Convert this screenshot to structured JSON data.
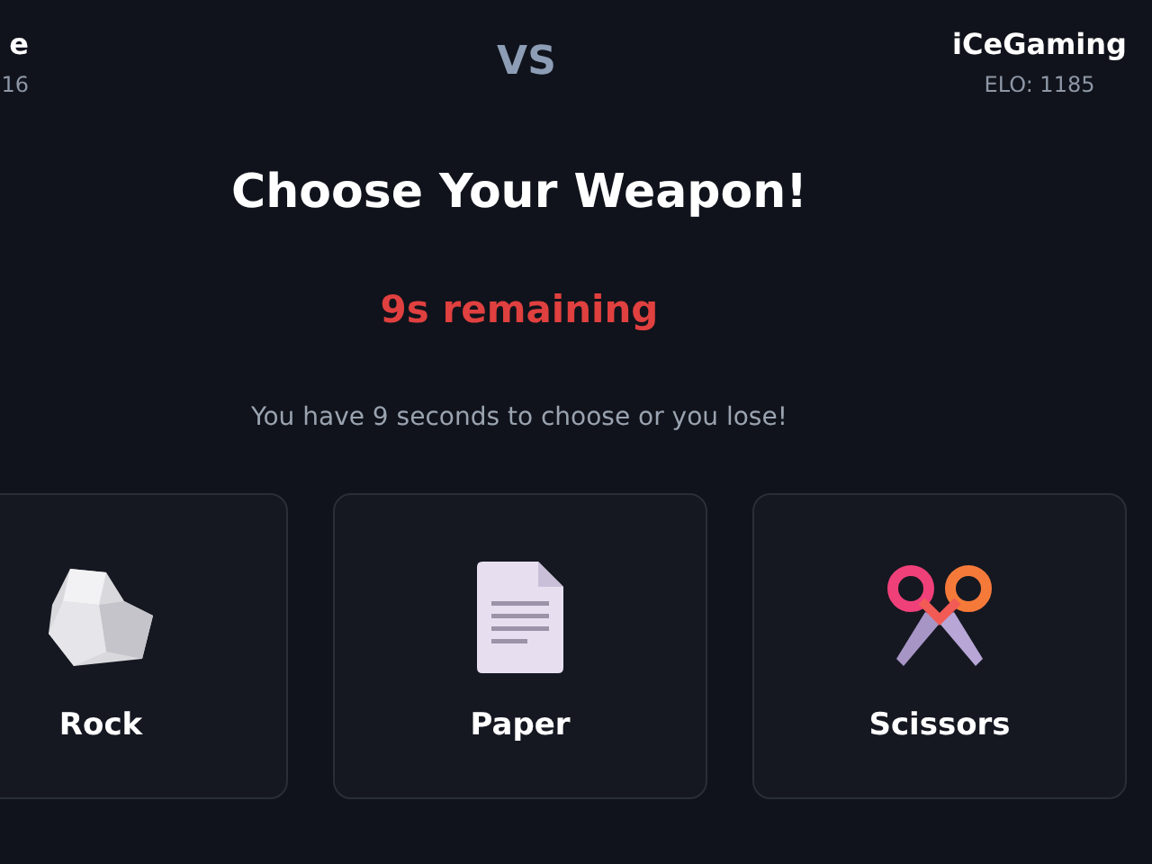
{
  "players": [
    {
      "name": "e",
      "elo": "16"
    },
    {
      "name": "iCeGaming",
      "elo": "ELO: 1185"
    }
  ],
  "versus": "VS",
  "title": "Choose Your Weapon!",
  "timer": "9s remaining",
  "hint": "You have 9 seconds to choose or you lose!",
  "choices": [
    {
      "kind": "rock",
      "label": "Rock"
    },
    {
      "kind": "paper",
      "label": "Paper"
    },
    {
      "kind": "scissors",
      "label": "Scissors"
    }
  ]
}
